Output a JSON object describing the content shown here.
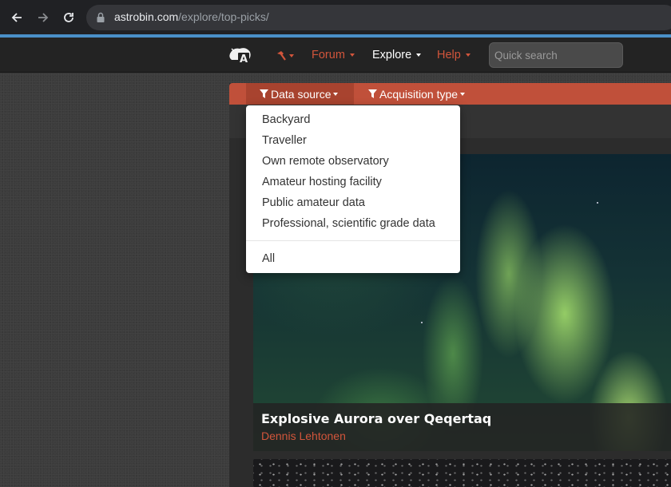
{
  "browser": {
    "url_domain": "astrobin.com",
    "url_path": "/explore/top-picks/"
  },
  "nav": {
    "forum_label": "Forum",
    "explore_label": "Explore",
    "help_label": "Help",
    "search_placeholder": "Quick search",
    "logo_letter": "A"
  },
  "filters": {
    "data_source_label": "Data source",
    "acquisition_type_label": "Acquisition type"
  },
  "dropdown": {
    "items": [
      "Backyard",
      "Traveller",
      "Own remote observatory",
      "Amateur hosting facility",
      "Public amateur data",
      "Professional, scientific grade data"
    ],
    "all_label": "All"
  },
  "image_card": {
    "title": "Explosive Aurora over Qeqertaq",
    "author": "Dennis Lehtonen"
  },
  "colors": {
    "accent": "#d2553b",
    "filter_bar": "#c0503a",
    "nav_bg": "#232323",
    "chrome_bg": "#202124"
  }
}
